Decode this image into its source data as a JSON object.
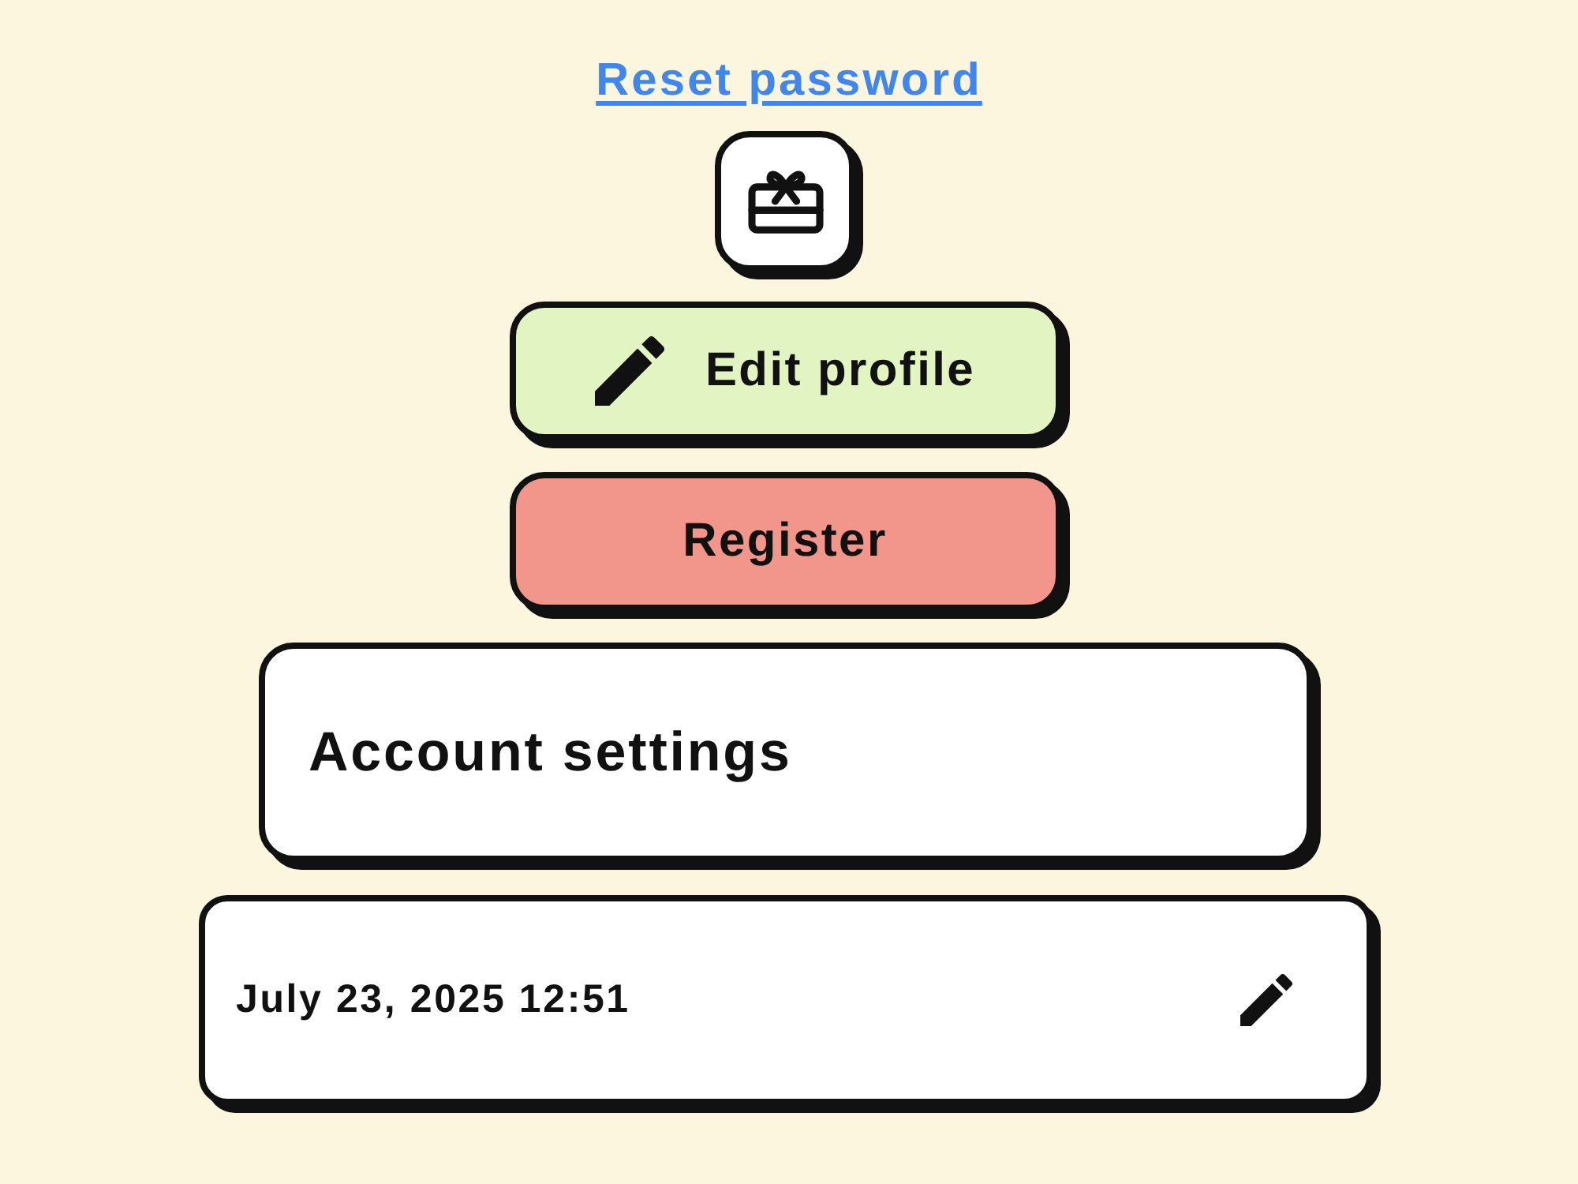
{
  "link": {
    "label": "Reset password"
  },
  "buttons": [
    {
      "kind": "icon"
    },
    {
      "kind": "icon_label",
      "label": "Edit profile",
      "color": "#e3f4c3"
    },
    {
      "kind": "label",
      "label": "Register",
      "color": "#f2968b"
    }
  ],
  "card": {
    "title": "Account settings"
  },
  "datetime_field": {
    "value": "July 23, 2025 12:51"
  }
}
